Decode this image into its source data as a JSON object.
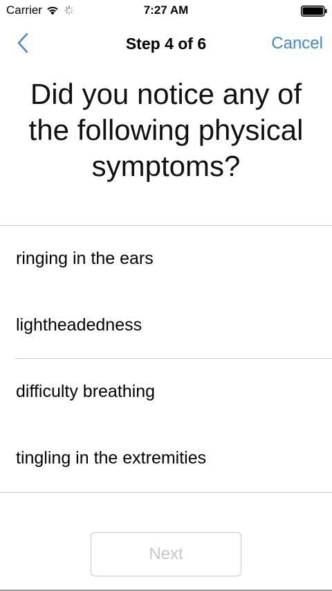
{
  "status_bar": {
    "carrier": "Carrier",
    "time": "7:27 AM",
    "wifi_icon": "wifi-icon",
    "activity_icon": "activity-spinner-icon",
    "battery_icon": "battery-full-icon"
  },
  "nav": {
    "back_icon": "chevron-left-icon",
    "title": "Step 4 of 6",
    "cancel_label": "Cancel",
    "accent_color": "#3b8bd6"
  },
  "question": {
    "text": "Did you notice any of the following physical symptoms?"
  },
  "options": [
    {
      "label": "ringing in the ears"
    },
    {
      "label": "lightheadedness"
    },
    {
      "label": "difficulty breathing"
    },
    {
      "label": "tingling in the extremities"
    }
  ],
  "footer": {
    "next_label": "Next",
    "next_enabled": false,
    "disabled_color": "#c7c7cc"
  }
}
